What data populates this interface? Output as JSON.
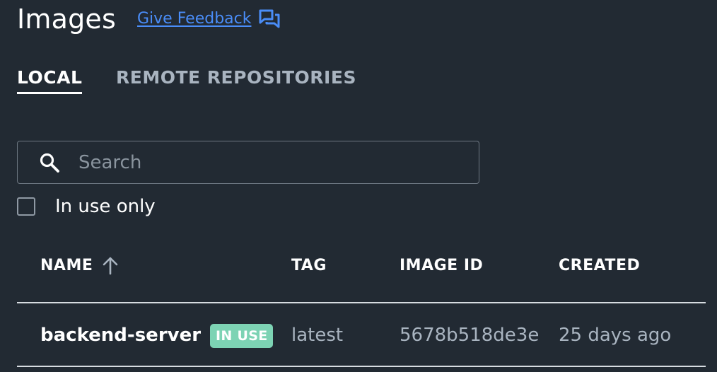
{
  "header": {
    "title": "Images",
    "feedback_label": "Give Feedback",
    "feedback_icon": "feedback-chat-icon"
  },
  "tabs": [
    {
      "label": "LOCAL",
      "active": true
    },
    {
      "label": "REMOTE REPOSITORIES",
      "active": false
    }
  ],
  "search": {
    "placeholder": "Search",
    "value": "",
    "icon": "search-icon"
  },
  "filter": {
    "in_use_only_label": "In use only",
    "checked": false
  },
  "table": {
    "columns": [
      {
        "label": "NAME",
        "sort": "ascending"
      },
      {
        "label": "TAG"
      },
      {
        "label": "IMAGE ID"
      },
      {
        "label": "CREATED"
      }
    ],
    "rows": [
      {
        "name": "backend-server",
        "badge": "IN USE",
        "tag": "latest",
        "image_id": "5678b518de3e",
        "created": "25 days ago"
      }
    ]
  },
  "colors": {
    "background": "#222a33",
    "link": "#4a8df8",
    "badge": "#7dd3b4",
    "muted_text": "#a9b4c0"
  }
}
